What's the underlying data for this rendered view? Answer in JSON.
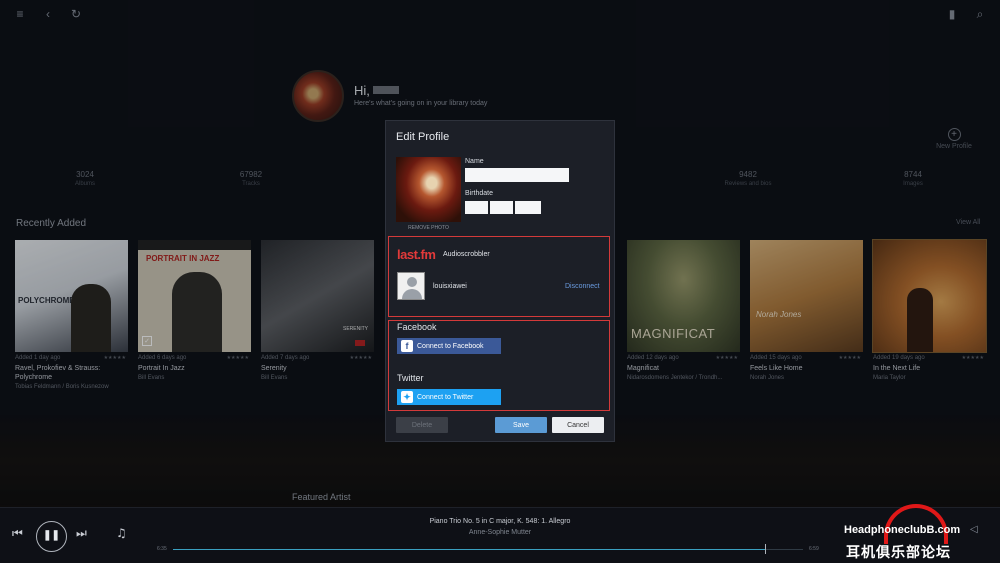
{
  "hero": {
    "greeting": "Hi,",
    "subtitle": "Here's what's going on in your library today",
    "new_profile": "New Profile"
  },
  "stats": [
    {
      "value": "3024",
      "label": "Albums"
    },
    {
      "value": "67982",
      "label": "Tracks"
    },
    {
      "value": "9482",
      "label": "Reviews and bios"
    },
    {
      "value": "8744",
      "label": "Images"
    }
  ],
  "recently_added": {
    "title": "Recently Added",
    "view_all": "View All",
    "albums": [
      {
        "added": "Added 1 day ago",
        "title": "Ravel, Prokofiev & Strauss: Polychrome",
        "artist": "Tobias Feldmann / Boris Kusnezow",
        "cover_text": "POLYCHROME"
      },
      {
        "added": "Added 6 days ago",
        "title": "Portrait In Jazz",
        "artist": "Bill Evans",
        "cover_text": "PORTRAIT IN JAZZ"
      },
      {
        "added": "Added 7 days ago",
        "title": "Serenity",
        "artist": "Bill Evans",
        "cover_text": "SERENITY"
      },
      {
        "added": "Added 12 days ago",
        "title": "Magnificat",
        "artist": "Nidarosdomens Jentekor / Trondh...",
        "cover_text": "MAGNIFICAT"
      },
      {
        "added": "Added 15 days ago",
        "title": "Feels Like Home",
        "artist": "Norah Jones",
        "cover_text": "Norah Jones"
      },
      {
        "added": "Added 19 days ago",
        "title": "In the Next Life",
        "artist": "Maria Taylor",
        "cover_text": ""
      }
    ]
  },
  "featured_artist": "Featured Artist",
  "modal": {
    "title": "Edit Profile",
    "remove_photo": "REMOVE PHOTO",
    "name_label": "Name",
    "birthdate_label": "Birthdate",
    "lastfm_logo": "last.fm",
    "audioscrobbler": "Audioscrobbler",
    "lastfm_user": "louisxiawei",
    "disconnect": "Disconnect",
    "facebook_label": "Facebook",
    "facebook_button": "Connect to Facebook",
    "twitter_label": "Twitter",
    "twitter_button": "Connect to Twitter",
    "delete_button": "Delete",
    "save_button": "Save",
    "cancel_button": "Cancel"
  },
  "player": {
    "track": "Piano Trio No. 5 in C major, K. 548: 1. Allegro",
    "artist": "Anne-Sophie Mutter",
    "elapsed": "6:35",
    "duration": "6:59",
    "progress": 0.94
  },
  "watermark": {
    "line1": "HeadphoneclubB.com",
    "line2": "耳机俱乐部论坛"
  },
  "colors": {
    "accent_red": "#d33a3a",
    "facebook": "#3b5998",
    "twitter": "#1da1f2",
    "save": "#5b9bd5"
  }
}
